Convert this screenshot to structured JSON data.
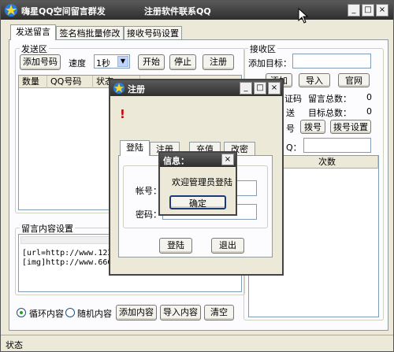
{
  "main": {
    "title": "嗨星QQ空间留言群发",
    "contact": "注册软件联系QQ",
    "tabs": [
      "发送留言",
      "签名档批量修改",
      "接收号码设置"
    ],
    "send_area": {
      "legend": "发送区",
      "add_number": "添加号码",
      "speed_label": "速度",
      "speed_value": "1秒",
      "start": "开始",
      "stop": "停止",
      "register": "注册",
      "columns": [
        "数量",
        "QQ号码",
        "状态"
      ]
    },
    "receive_area": {
      "legend": "接收区",
      "add_target_label": "添加目标：",
      "add": "添加",
      "import": "导入",
      "official_site": "官网",
      "verify_code": "证码",
      "message_total_label": "留言总数：",
      "message_total": "0",
      "send_label": "送",
      "target_total_label": "目标总数：",
      "target_total": "0",
      "number_label": "号",
      "dial": "拨号",
      "dial_settings": "拨号设置",
      "q_label": "Q：",
      "count_col": "次数"
    },
    "content_area": {
      "legend": "留言内容设置",
      "line1": "[url=http://www.12345",
      "line2": "[img]http://www.66666"
    },
    "bottom": {
      "loop": "循环内容",
      "random": "随机内容",
      "add_content": "添加内容",
      "import_content": "导入内容",
      "clear": "清空"
    },
    "status": "状态"
  },
  "register_dialog": {
    "title": "注册",
    "warning": "!",
    "tabs": [
      "登陆",
      "注册",
      "充值",
      "改密"
    ],
    "account_label": "帐号：",
    "password_label": "密码：",
    "login": "登陆",
    "exit": "退出"
  },
  "info_dialog": {
    "title": "信息：",
    "message": "欢迎管理员登陆",
    "ok": "确定"
  }
}
